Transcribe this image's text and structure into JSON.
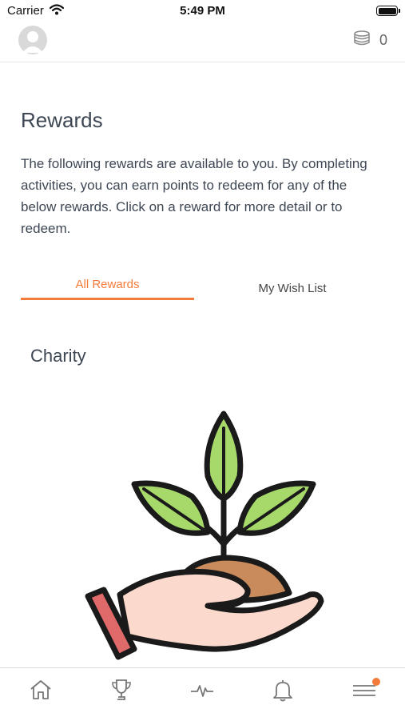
{
  "status_bar": {
    "carrier": "Carrier",
    "time": "5:49 PM"
  },
  "header": {
    "points": "0",
    "icons": [
      "avatar",
      "coins-icon"
    ]
  },
  "page": {
    "title": "Rewards",
    "intro": "The following rewards are available to you. By completing activities, you can earn points to redeem for any of the below rewards. Click on a reward for more detail or to redeem."
  },
  "tabs": [
    {
      "label": "All Rewards",
      "active": true
    },
    {
      "label": "My Wish List",
      "active": false
    }
  ],
  "section": {
    "title": "Charity",
    "image_icon": "plant-in-hand-illustration"
  },
  "bottom_nav": {
    "items": [
      "home-icon",
      "trophy-icon",
      "activity-icon",
      "bell-icon",
      "menu-icon"
    ],
    "menu_has_badge": true
  },
  "colors": {
    "accent": "#f47b3a",
    "text": "#3e4754",
    "leaf": "#a6d96a",
    "soil": "#c98a5c",
    "cuff": "#e06a6a",
    "hand": "#fbd9cc"
  }
}
